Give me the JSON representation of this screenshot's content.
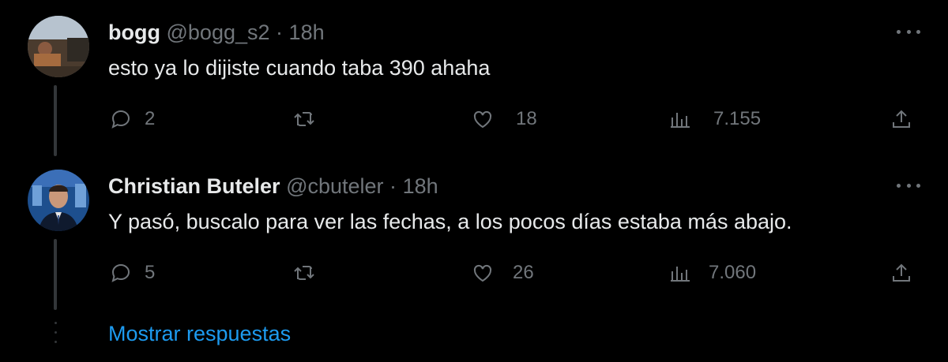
{
  "tweets": [
    {
      "name": "bogg",
      "handle": "@bogg_s2",
      "separator": "·",
      "time": "18h",
      "text": "esto ya lo dijiste cuando taba 390 ahaha",
      "replies": "2",
      "retweets": "",
      "likes": "18",
      "views": "7.155"
    },
    {
      "name": "Christian Buteler",
      "handle": "@cbuteler",
      "separator": "·",
      "time": "18h",
      "text": "Y pasó, buscalo para ver las fechas, a los pocos días estaba más abajo.",
      "replies": "5",
      "retweets": "",
      "likes": "26",
      "views": "7.060"
    }
  ],
  "show_replies": "Mostrar respuestas",
  "colors": {
    "background": "#000000",
    "primary_text": "#e7e9ea",
    "secondary_text": "#71767b",
    "link": "#1d9bf0",
    "thread_line": "#333639"
  }
}
